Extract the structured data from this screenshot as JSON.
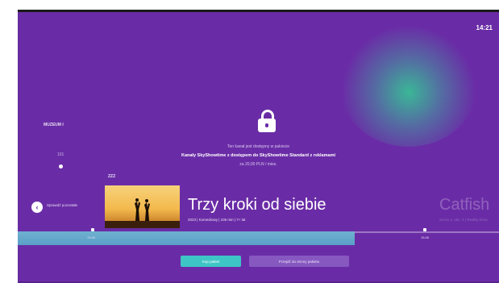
{
  "screen": {
    "clock": "14:21",
    "background_color": "#6a2ca6",
    "accent_color": "#3ec6c6"
  },
  "channel": {
    "name": "MUZEUM I",
    "number": "101"
  },
  "lock_message": {
    "icon": "lock-icon",
    "line1": "Ten kanał jest dostępny w pakiecie",
    "line2": "Kanały SkyShowtime z dostępem do SkyShowtime Standard z reklamami",
    "line3": "za 20,00 PLN / mies."
  },
  "program": {
    "time_label": "ZZZ",
    "title": "Trzy kroki od siebie",
    "meta": "2023 | Komediowy | 105 min | 7+ lat",
    "thumbnail_icon": "movie-thumbnail-image"
  },
  "next_program": {
    "title": "Catfish",
    "meta": "sezon 1, odc. 4 | Reality show"
  },
  "back": {
    "icon": "back-arrow-icon",
    "label": "Sprawdź pozostałe"
  },
  "timeline": {
    "progress_fraction": 0.7,
    "start_tick": "13:45",
    "end_tick": "15:45"
  },
  "actions": {
    "primary_label": "Kup pakiet",
    "secondary_label": "Przejdź do strony pakietu"
  }
}
